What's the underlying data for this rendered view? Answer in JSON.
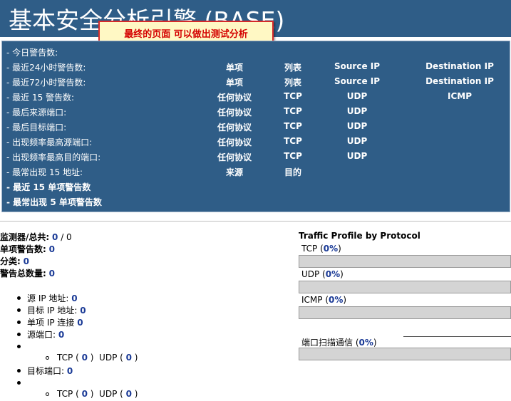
{
  "header": {
    "title": "基本安全分析引擎 (BASE)",
    "callout": "最终的页面  可以做出测试分析"
  },
  "stats": [
    {
      "label": "- 今日警告数:",
      "bold": false,
      "cells": [
        "",
        "",
        "",
        ""
      ]
    },
    {
      "label": "- 最近24小时警告数:",
      "bold": false,
      "cells": [
        "单项",
        "列表",
        "Source IP",
        "Destination IP"
      ]
    },
    {
      "label": "- 最近72小时警告数:",
      "bold": false,
      "cells": [
        "单项",
        "列表",
        "Source IP",
        "Destination IP"
      ]
    },
    {
      "label": "- 最近  15 警告数:",
      "bold": false,
      "cells": [
        "任何协议",
        "TCP",
        "UDP",
        "ICMP"
      ]
    },
    {
      "label": "- 最后来源端口:",
      "bold": false,
      "cells": [
        "任何协议",
        "TCP",
        "UDP",
        ""
      ]
    },
    {
      "label": "- 最后目标端口:",
      "bold": false,
      "cells": [
        "任何协议",
        "TCP",
        "UDP",
        ""
      ]
    },
    {
      "label": "- 出现频率最高源端口:",
      "bold": false,
      "cells": [
        "任何协议",
        "TCP",
        "UDP",
        ""
      ]
    },
    {
      "label": "- 出现频率最高目的端口:",
      "bold": false,
      "cells": [
        "任何协议",
        "TCP",
        "UDP",
        ""
      ]
    },
    {
      "label": "- 最常出现  15 地址:",
      "bold": false,
      "cells": [
        "来源",
        "目的",
        "",
        ""
      ]
    },
    {
      "label": "- 最近  15 单项警告数",
      "bold": true,
      "cells": [
        "",
        "",
        "",
        ""
      ]
    },
    {
      "label": "- 最常出现  5 单项警告数",
      "bold": true,
      "cells": [
        "",
        "",
        "",
        ""
      ]
    }
  ],
  "summary": {
    "sensors_label": "监测器/总共:",
    "sensors_value": "0",
    "sensors_sep": " / ",
    "sensors_total": "0",
    "unique_alerts_label": "单项警告数:",
    "unique_alerts_value": "0",
    "categories_label": "分类:",
    "categories_value": "0",
    "total_alerts_label": "警告总数量:",
    "total_alerts_value": "0"
  },
  "list": {
    "src_ip_label": "源  IP 地址:",
    "src_ip_value": "0",
    "dst_ip_label": "目标  IP 地址:",
    "dst_ip_value": "0",
    "ip_links_label": "单项  IP 连接",
    "ip_links_value": "0",
    "src_port_label": "源端口:",
    "src_port_value": "0",
    "dst_port_label": "目标端口:",
    "dst_port_value": "0",
    "tcp_label": "TCP",
    "udp_label": "UDP",
    "src_tcp_value": "0",
    "src_udp_value": "0",
    "dst_tcp_value": "0",
    "dst_udp_value": "0"
  },
  "traffic": {
    "title": "Traffic Profile by Protocol",
    "protocols": [
      {
        "name": "TCP",
        "pct": "0%",
        "fraction": 0
      },
      {
        "name": "UDP",
        "pct": "0%",
        "fraction": 0
      },
      {
        "name": "ICMP",
        "pct": "0%",
        "fraction": 0
      }
    ],
    "portscan_label": "端口扫描通信",
    "portscan_pct": "0%",
    "portscan_fraction": 0
  },
  "colors": {
    "panel": "#2f5d87",
    "link": "#1a3a96",
    "callout_border": "#d42a2a",
    "callout_text": "#d40000"
  }
}
